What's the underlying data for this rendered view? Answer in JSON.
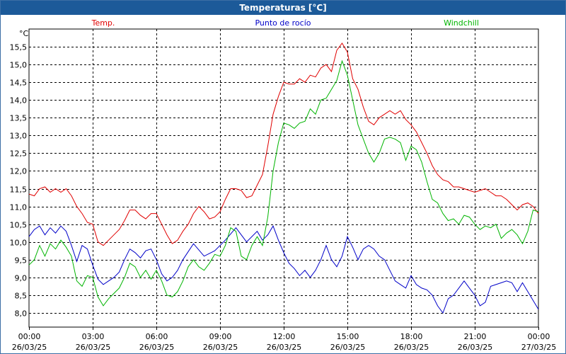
{
  "window": {
    "title": "Temperaturas [°C]"
  },
  "chart_data": {
    "type": "line",
    "title": "Temperaturas [°C]",
    "ylabel": "°C",
    "xlabel": "",
    "ylim": [
      7.6,
      16.0
    ],
    "xlim": [
      0,
      24
    ],
    "grid": true,
    "legend_placement": "top",
    "y_ticks": [
      "8,0",
      "8,5",
      "9,0",
      "9,5",
      "10,0",
      "10,5",
      "11,0",
      "11,5",
      "12,0",
      "12,5",
      "13,0",
      "13,5",
      "14,0",
      "14,5",
      "15,0",
      "15,5"
    ],
    "y_tick_values": [
      8.0,
      8.5,
      9.0,
      9.5,
      10.0,
      10.5,
      11.0,
      11.5,
      12.0,
      12.5,
      13.0,
      13.5,
      14.0,
      14.5,
      15.0,
      15.5
    ],
    "x_ticks": [
      {
        "value": 0,
        "time": "00:00",
        "date": "26/03/25"
      },
      {
        "value": 3,
        "time": "03:00",
        "date": "26/03/25"
      },
      {
        "value": 6,
        "time": "06:00",
        "date": "26/03/25"
      },
      {
        "value": 9,
        "time": "09:00",
        "date": "26/03/25"
      },
      {
        "value": 12,
        "time": "12:00",
        "date": "26/03/25"
      },
      {
        "value": 15,
        "time": "15:00",
        "date": "26/03/25"
      },
      {
        "value": 18,
        "time": "18:00",
        "date": "26/03/25"
      },
      {
        "value": 21,
        "time": "21:00",
        "date": "26/03/25"
      },
      {
        "value": 24,
        "time": "00:00",
        "date": "27/03/25"
      }
    ],
    "series": [
      {
        "name": "Temp.",
        "color": "#e00000",
        "points": [
          [
            0,
            11.35
          ],
          [
            0.25,
            11.3
          ],
          [
            0.5,
            11.5
          ],
          [
            0.75,
            11.55
          ],
          [
            1,
            11.4
          ],
          [
            1.25,
            11.5
          ],
          [
            1.5,
            11.4
          ],
          [
            1.75,
            11.5
          ],
          [
            2,
            11.3
          ],
          [
            2.25,
            11.0
          ],
          [
            2.5,
            10.8
          ],
          [
            2.75,
            10.55
          ],
          [
            3,
            10.5
          ],
          [
            3.25,
            10.0
          ],
          [
            3.5,
            9.9
          ],
          [
            3.75,
            10.05
          ],
          [
            4,
            10.2
          ],
          [
            4.25,
            10.35
          ],
          [
            4.5,
            10.6
          ],
          [
            4.75,
            10.9
          ],
          [
            5,
            10.9
          ],
          [
            5.25,
            10.75
          ],
          [
            5.5,
            10.65
          ],
          [
            5.75,
            10.8
          ],
          [
            6,
            10.8
          ],
          [
            6.25,
            10.5
          ],
          [
            6.5,
            10.2
          ],
          [
            6.75,
            9.95
          ],
          [
            7,
            10.05
          ],
          [
            7.25,
            10.3
          ],
          [
            7.5,
            10.5
          ],
          [
            7.75,
            10.8
          ],
          [
            8,
            11.0
          ],
          [
            8.25,
            10.85
          ],
          [
            8.5,
            10.65
          ],
          [
            8.75,
            10.7
          ],
          [
            9,
            10.85
          ],
          [
            9.25,
            11.2
          ],
          [
            9.5,
            11.5
          ],
          [
            9.75,
            11.5
          ],
          [
            10,
            11.45
          ],
          [
            10.25,
            11.25
          ],
          [
            10.5,
            11.3
          ],
          [
            10.75,
            11.6
          ],
          [
            11,
            11.9
          ],
          [
            11.25,
            12.7
          ],
          [
            11.5,
            13.6
          ],
          [
            11.75,
            14.1
          ],
          [
            12,
            14.5
          ],
          [
            12.25,
            14.45
          ],
          [
            12.5,
            14.45
          ],
          [
            12.75,
            14.6
          ],
          [
            13,
            14.5
          ],
          [
            13.25,
            14.7
          ],
          [
            13.5,
            14.65
          ],
          [
            13.75,
            14.9
          ],
          [
            14,
            15.0
          ],
          [
            14.25,
            14.8
          ],
          [
            14.5,
            15.4
          ],
          [
            14.75,
            15.6
          ],
          [
            15,
            15.35
          ],
          [
            15.25,
            14.6
          ],
          [
            15.5,
            14.3
          ],
          [
            15.75,
            13.8
          ],
          [
            16,
            13.4
          ],
          [
            16.25,
            13.3
          ],
          [
            16.5,
            13.5
          ],
          [
            16.75,
            13.6
          ],
          [
            17,
            13.7
          ],
          [
            17.25,
            13.6
          ],
          [
            17.5,
            13.7
          ],
          [
            17.75,
            13.45
          ],
          [
            18,
            13.3
          ],
          [
            18.25,
            13.1
          ],
          [
            18.5,
            12.8
          ],
          [
            18.75,
            12.5
          ],
          [
            19,
            12.15
          ],
          [
            19.25,
            11.9
          ],
          [
            19.5,
            11.75
          ],
          [
            19.75,
            11.7
          ],
          [
            20,
            11.55
          ],
          [
            20.25,
            11.55
          ],
          [
            20.5,
            11.5
          ],
          [
            20.75,
            11.45
          ],
          [
            21,
            11.4
          ],
          [
            21.25,
            11.45
          ],
          [
            21.5,
            11.5
          ],
          [
            21.75,
            11.4
          ],
          [
            22,
            11.3
          ],
          [
            22.25,
            11.3
          ],
          [
            22.5,
            11.2
          ],
          [
            22.75,
            11.05
          ],
          [
            23,
            10.9
          ],
          [
            23.25,
            11.05
          ],
          [
            23.5,
            11.1
          ],
          [
            23.75,
            11.0
          ],
          [
            24,
            10.8
          ]
        ]
      },
      {
        "name": "Punto de rocío",
        "color": "#0000c8",
        "points": [
          [
            0,
            10.15
          ],
          [
            0.25,
            10.35
          ],
          [
            0.5,
            10.45
          ],
          [
            0.75,
            10.2
          ],
          [
            1,
            10.4
          ],
          [
            1.25,
            10.25
          ],
          [
            1.5,
            10.45
          ],
          [
            1.75,
            10.3
          ],
          [
            2,
            9.9
          ],
          [
            2.25,
            9.45
          ],
          [
            2.5,
            9.9
          ],
          [
            2.75,
            9.8
          ],
          [
            3,
            9.35
          ],
          [
            3.25,
            8.95
          ],
          [
            3.5,
            8.8
          ],
          [
            3.75,
            8.9
          ],
          [
            4,
            9.0
          ],
          [
            4.25,
            9.15
          ],
          [
            4.5,
            9.5
          ],
          [
            4.75,
            9.8
          ],
          [
            5,
            9.7
          ],
          [
            5.25,
            9.55
          ],
          [
            5.5,
            9.75
          ],
          [
            5.75,
            9.8
          ],
          [
            6,
            9.5
          ],
          [
            6.25,
            9.1
          ],
          [
            6.5,
            8.9
          ],
          [
            6.75,
            9.0
          ],
          [
            7,
            9.2
          ],
          [
            7.25,
            9.5
          ],
          [
            7.75,
            9.95
          ],
          [
            8.25,
            9.6
          ],
          [
            8.75,
            9.75
          ],
          [
            9.25,
            10.05
          ],
          [
            9.75,
            10.4
          ],
          [
            10.25,
            10.0
          ],
          [
            10.75,
            10.3
          ],
          [
            11,
            10.05
          ],
          [
            11.25,
            10.2
          ],
          [
            11.5,
            10.45
          ],
          [
            11.75,
            10.05
          ],
          [
            12,
            9.7
          ],
          [
            12.25,
            9.4
          ],
          [
            12.5,
            9.25
          ],
          [
            12.75,
            9.05
          ],
          [
            13,
            9.2
          ],
          [
            13.25,
            9.0
          ],
          [
            13.5,
            9.2
          ],
          [
            13.75,
            9.5
          ],
          [
            14,
            9.9
          ],
          [
            14.25,
            9.5
          ],
          [
            14.5,
            9.3
          ],
          [
            14.75,
            9.6
          ],
          [
            15,
            10.15
          ],
          [
            15.25,
            9.85
          ],
          [
            15.5,
            9.5
          ],
          [
            15.75,
            9.8
          ],
          [
            16,
            9.9
          ],
          [
            16.25,
            9.8
          ],
          [
            16.5,
            9.6
          ],
          [
            16.75,
            9.5
          ],
          [
            17,
            9.2
          ],
          [
            17.25,
            8.9
          ],
          [
            17.5,
            8.8
          ],
          [
            17.75,
            8.7
          ],
          [
            18,
            9.05
          ],
          [
            18.25,
            8.8
          ],
          [
            18.5,
            8.7
          ],
          [
            18.75,
            8.65
          ],
          [
            19,
            8.5
          ],
          [
            19.25,
            8.2
          ],
          [
            19.5,
            8.0
          ],
          [
            19.75,
            8.4
          ],
          [
            20,
            8.5
          ],
          [
            20.25,
            8.7
          ],
          [
            20.5,
            8.9
          ],
          [
            20.75,
            8.7
          ],
          [
            21,
            8.5
          ],
          [
            21.25,
            8.2
          ],
          [
            21.5,
            8.3
          ],
          [
            21.75,
            8.75
          ],
          [
            22,
            8.8
          ],
          [
            22.25,
            8.85
          ],
          [
            22.5,
            8.9
          ],
          [
            22.75,
            8.85
          ],
          [
            23,
            8.6
          ],
          [
            23.25,
            8.85
          ],
          [
            23.5,
            8.6
          ],
          [
            23.75,
            8.35
          ],
          [
            24,
            8.1
          ]
        ]
      },
      {
        "name": "Windchill",
        "color": "#00b400",
        "points": [
          [
            0,
            9.35
          ],
          [
            0.25,
            9.5
          ],
          [
            0.5,
            9.9
          ],
          [
            0.75,
            9.6
          ],
          [
            1,
            9.95
          ],
          [
            1.25,
            9.8
          ],
          [
            1.5,
            10.05
          ],
          [
            1.75,
            9.85
          ],
          [
            2,
            9.6
          ],
          [
            2.25,
            8.9
          ],
          [
            2.5,
            8.75
          ],
          [
            2.75,
            9.05
          ],
          [
            3,
            9.0
          ],
          [
            3.25,
            8.45
          ],
          [
            3.5,
            8.2
          ],
          [
            3.75,
            8.4
          ],
          [
            4,
            8.55
          ],
          [
            4.25,
            8.7
          ],
          [
            4.5,
            9.0
          ],
          [
            4.75,
            9.4
          ],
          [
            5,
            9.3
          ],
          [
            5.25,
            9.0
          ],
          [
            5.5,
            9.2
          ],
          [
            5.75,
            8.95
          ],
          [
            6,
            9.2
          ],
          [
            6.25,
            8.9
          ],
          [
            6.5,
            8.5
          ],
          [
            6.75,
            8.45
          ],
          [
            7,
            8.6
          ],
          [
            7.25,
            8.9
          ],
          [
            7.5,
            9.3
          ],
          [
            7.75,
            9.5
          ],
          [
            8,
            9.3
          ],
          [
            8.25,
            9.2
          ],
          [
            8.5,
            9.4
          ],
          [
            8.75,
            9.65
          ],
          [
            9,
            9.6
          ],
          [
            9.25,
            9.9
          ],
          [
            9.5,
            10.4
          ],
          [
            9.75,
            10.3
          ],
          [
            10,
            9.6
          ],
          [
            10.25,
            9.5
          ],
          [
            10.5,
            9.9
          ],
          [
            10.75,
            10.15
          ],
          [
            11,
            9.9
          ],
          [
            11.25,
            10.7
          ],
          [
            11.5,
            12.0
          ],
          [
            11.75,
            12.8
          ],
          [
            12,
            13.35
          ],
          [
            12.25,
            13.3
          ],
          [
            12.5,
            13.2
          ],
          [
            12.75,
            13.35
          ],
          [
            13,
            13.4
          ],
          [
            13.25,
            13.75
          ],
          [
            13.5,
            13.6
          ],
          [
            13.75,
            14.0
          ],
          [
            14,
            14.05
          ],
          [
            14.25,
            14.3
          ],
          [
            14.5,
            14.55
          ],
          [
            14.75,
            15.1
          ],
          [
            15,
            14.7
          ],
          [
            15.25,
            14.0
          ],
          [
            15.5,
            13.3
          ],
          [
            15.75,
            12.9
          ],
          [
            16,
            12.5
          ],
          [
            16.25,
            12.25
          ],
          [
            16.5,
            12.5
          ],
          [
            16.75,
            12.9
          ],
          [
            17,
            12.95
          ],
          [
            17.25,
            12.9
          ],
          [
            17.5,
            12.8
          ],
          [
            17.75,
            12.3
          ],
          [
            18,
            12.7
          ],
          [
            18.25,
            12.6
          ],
          [
            18.5,
            12.25
          ],
          [
            18.75,
            11.7
          ],
          [
            19,
            11.2
          ],
          [
            19.25,
            11.1
          ],
          [
            19.5,
            10.8
          ],
          [
            19.75,
            10.6
          ],
          [
            20,
            10.65
          ],
          [
            20.25,
            10.5
          ],
          [
            20.5,
            10.75
          ],
          [
            20.75,
            10.7
          ],
          [
            21,
            10.5
          ],
          [
            21.25,
            10.35
          ],
          [
            21.5,
            10.45
          ],
          [
            21.75,
            10.4
          ],
          [
            22,
            10.5
          ],
          [
            22.25,
            10.1
          ],
          [
            22.5,
            10.25
          ],
          [
            22.75,
            10.35
          ],
          [
            23,
            10.2
          ],
          [
            23.25,
            9.95
          ],
          [
            23.5,
            10.3
          ],
          [
            23.75,
            10.9
          ],
          [
            24,
            10.85
          ]
        ]
      }
    ]
  }
}
